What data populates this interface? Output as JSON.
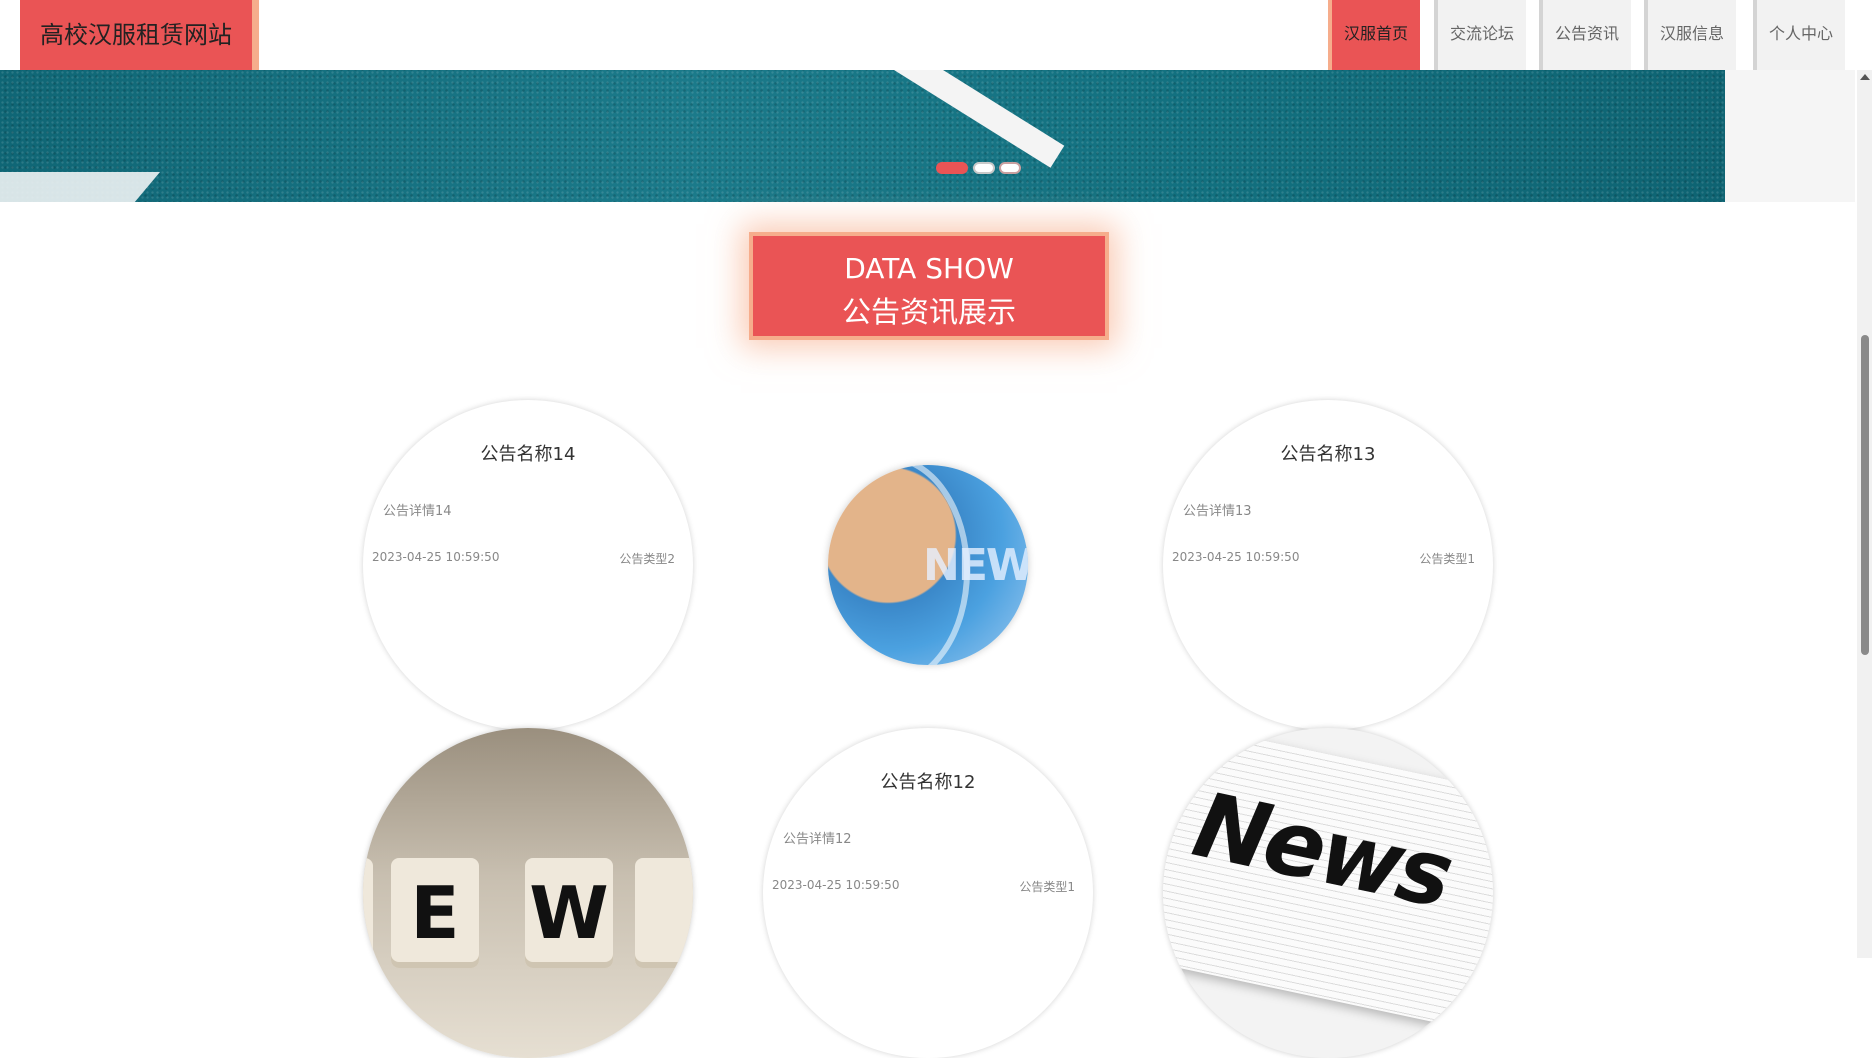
{
  "site": {
    "title": "高校汉服租赁网站"
  },
  "nav": [
    {
      "label": "汉服首页",
      "active": true
    },
    {
      "label": "交流论坛"
    },
    {
      "label": "公告资讯"
    },
    {
      "label": "汉服信息"
    },
    {
      "label": "个人中心"
    }
  ],
  "section": {
    "title_en": "DATA SHOW",
    "title_cn": "公告资讯展示"
  },
  "notices": [
    {
      "title": "公告名称14",
      "detail": "公告详情14",
      "date": "2023-04-25 10:59:50",
      "type": "公告类型2"
    },
    {
      "title": "公告名称13",
      "detail": "公告详情13",
      "date": "2023-04-25 10:59:50",
      "type": "公告类型1"
    },
    {
      "title": "公告名称12",
      "detail": "公告详情12",
      "date": "2023-04-25 10:59:50",
      "type": "公告类型1"
    }
  ],
  "images": {
    "globe_word": "NEW",
    "cube_letters": [
      "E",
      "W"
    ],
    "news_word": "News"
  },
  "colors": {
    "accent": "#ea5455",
    "accent_border": "#f6ad8c"
  }
}
